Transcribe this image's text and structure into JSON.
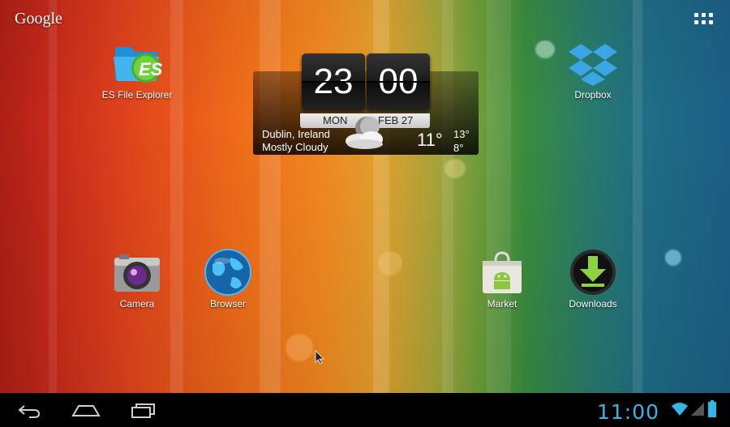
{
  "search": {
    "label": "Google"
  },
  "apps": [
    {
      "id": "es",
      "label": "ES File Explorer"
    },
    {
      "id": "dropbox",
      "label": "Dropbox"
    },
    {
      "id": "camera",
      "label": "Camera"
    },
    {
      "id": "browser",
      "label": "Browser"
    },
    {
      "id": "market",
      "label": "Market"
    },
    {
      "id": "downloads",
      "label": "Downloads"
    }
  ],
  "clock_widget": {
    "hour": "23",
    "minute": "00",
    "day": "MON",
    "date": "FEB 27",
    "location": "Dublin, Ireland",
    "condition": "Mostly Cloudy",
    "temp": "11°",
    "high": "13°",
    "low": "8°",
    "weather_icon": "cloudy-moon-icon"
  },
  "status_bar": {
    "time": "11:00",
    "icons": [
      "wifi-icon",
      "signal-icon",
      "battery-icon"
    ],
    "accent": "#33b5e5"
  },
  "nav": {
    "icons": [
      "back-icon",
      "home-icon",
      "recent-apps-icon"
    ]
  }
}
